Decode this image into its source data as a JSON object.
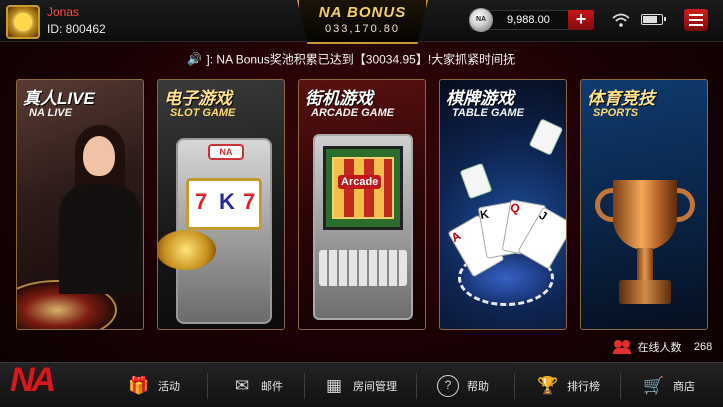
{
  "user": {
    "name": "Jonas",
    "id_label": "ID: 800462"
  },
  "bonus": {
    "title": "NA BONUS",
    "amount": "033,170.80"
  },
  "balance": {
    "coin_label": "NA",
    "value": "9,988.00",
    "add_label": "+"
  },
  "status": {
    "battery_level": 0.85
  },
  "marquee": {
    "speaker_glyph": "🔊",
    "text": "]: NA Bonus奖池积累已达到【30034.95】!大家抓紧时间抚"
  },
  "games": [
    {
      "title": "真人LIVE",
      "subtitle": "NA LIVE"
    },
    {
      "title": "电子游戏",
      "subtitle": "SLOT GAME"
    },
    {
      "title": "街机游戏",
      "subtitle": "ARCADE GAME"
    },
    {
      "title": "棋牌游戏",
      "subtitle": "TABLE GAME"
    },
    {
      "title": "体育竞技",
      "subtitle": "SPORTS"
    }
  ],
  "art": {
    "slot_badge": "NA",
    "slot_symbols": [
      "7",
      "K",
      "7"
    ],
    "arcade_logo": "Arcade",
    "cards": [
      "A",
      "K",
      "Q",
      "J"
    ]
  },
  "online": {
    "label": "在线人数",
    "count": "268"
  },
  "logo": "NA",
  "nav": [
    {
      "icon": "🎁",
      "label": "活动"
    },
    {
      "icon": "✉",
      "label": "邮件"
    },
    {
      "icon": "▦",
      "label": "房间管理"
    },
    {
      "icon": "?",
      "label": "帮助"
    },
    {
      "icon": "🏆",
      "label": "排行榜"
    },
    {
      "icon": "🛒",
      "label": "商店"
    }
  ]
}
